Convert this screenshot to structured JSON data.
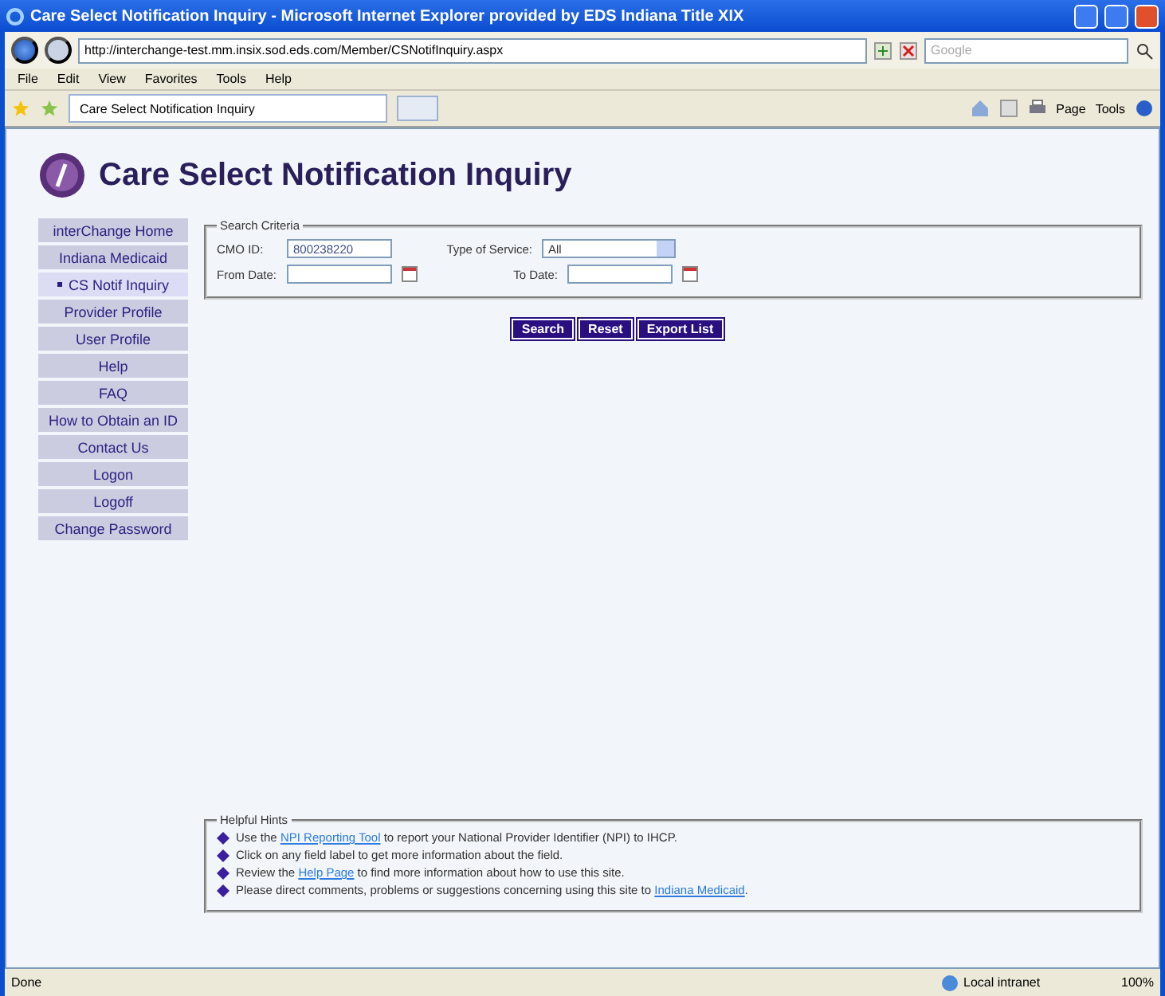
{
  "window": {
    "title": "Care Select Notification Inquiry - Microsoft Internet Explorer provided by EDS Indiana Title XIX"
  },
  "address_bar": {
    "url": "http://interchange-test.mm.insix.sod.eds.com/Member/CSNotifInquiry.aspx",
    "search_placeholder": "Google"
  },
  "menu": [
    "File",
    "Edit",
    "View",
    "Favorites",
    "Tools",
    "Help"
  ],
  "tabs": [
    {
      "label": "Care Select Notification Inquiry",
      "selected": true
    }
  ],
  "command_bar": [
    "Page",
    "Tools"
  ],
  "page": {
    "title": "Care Select Notification Inquiry",
    "sidebar": [
      {
        "label": "interChange Home",
        "selected": false
      },
      {
        "label": "Indiana Medicaid",
        "selected": false
      },
      {
        "label": "CS Notif Inquiry",
        "selected": true
      },
      {
        "label": "Provider Profile",
        "selected": false
      },
      {
        "label": "User Profile",
        "selected": false
      },
      {
        "label": "Help",
        "selected": false
      },
      {
        "label": "FAQ",
        "selected": false
      },
      {
        "label": "How to Obtain an ID",
        "selected": false
      },
      {
        "label": "Contact Us",
        "selected": false
      },
      {
        "label": "Logon",
        "selected": false
      },
      {
        "label": "Logoff",
        "selected": false
      },
      {
        "label": "Change Password",
        "selected": false
      }
    ],
    "search_criteria": {
      "legend": "Search Criteria",
      "cmo_id_label": "CMO ID:",
      "cmo_id_value": "800238220",
      "service_label": "Type of Service:",
      "service_value": "All",
      "from_label": "From Date:",
      "to_label": "To Date:"
    },
    "buttons": [
      "Search",
      "Reset",
      "Export List"
    ],
    "hints": {
      "legend": "Helpful Hints",
      "items": [
        {
          "text": "Use the ",
          "link": "NPI Reporting Tool",
          "after": " to report your National Provider Identifier (NPI) to IHCP."
        },
        {
          "text": "Click on any field label to get more information about the field."
        },
        {
          "text": "Review the ",
          "link": "Help Page",
          "after": " to find more information about how to use this site."
        },
        {
          "text": "Please direct comments, problems or suggestions concerning using this site to ",
          "link": "Indiana Medicaid",
          "after": "."
        }
      ]
    }
  },
  "status_bar": {
    "text": "Done",
    "zone": "Local intranet",
    "zoom": "100%"
  }
}
